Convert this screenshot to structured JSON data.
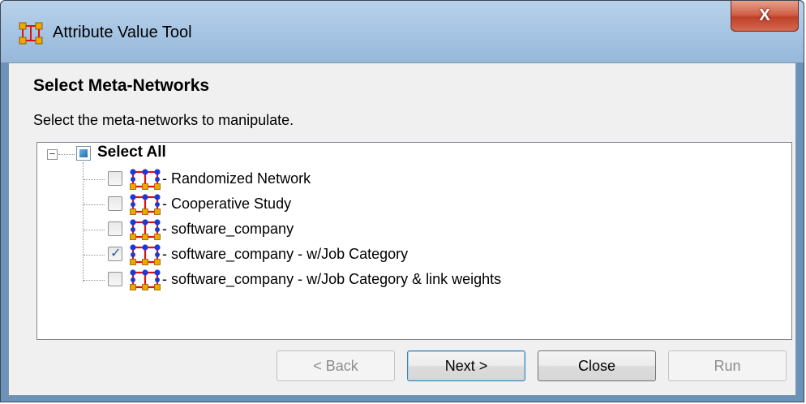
{
  "window": {
    "title": "Attribute Value Tool",
    "close_symbol": "X"
  },
  "wizard": {
    "title": "Select Meta-Networks",
    "description": "Select the meta-networks to manipulate."
  },
  "tree": {
    "expander_symbol": "−",
    "select_all": {
      "label": "Select All",
      "state": "partial"
    },
    "items": [
      {
        "label": "- Randomized Network",
        "checked": false,
        "icon": "meta-network-icon"
      },
      {
        "label": "- Cooperative Study",
        "checked": false,
        "icon": "meta-network-icon"
      },
      {
        "label": "- software_company",
        "checked": false,
        "icon": "meta-network-icon"
      },
      {
        "label": "- software_company - w/Job Category",
        "checked": true,
        "icon": "meta-network-icon"
      },
      {
        "label": "- software_company - w/Job Category & link weights",
        "checked": false,
        "icon": "meta-network-icon"
      }
    ]
  },
  "buttons": {
    "back": {
      "label": "< Back",
      "enabled": false
    },
    "next": {
      "label": "Next >",
      "enabled": true
    },
    "close": {
      "label": "Close",
      "enabled": true
    },
    "run": {
      "label": "Run",
      "enabled": false
    }
  },
  "colors": {
    "titlebar": "#a8c6e4",
    "close_button": "#c0412a",
    "select_all_fill": "#1f6fb0",
    "icon_nodes_blue": "#1a3ad8",
    "icon_nodes_orange": "#f0a800",
    "icon_links_red": "#e01010"
  }
}
